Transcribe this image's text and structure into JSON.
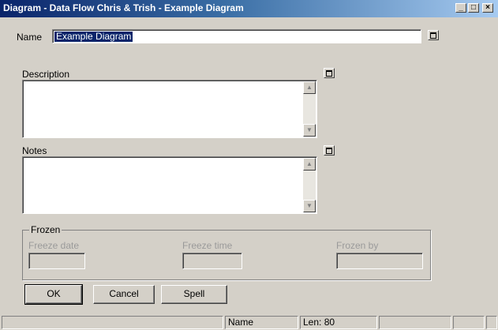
{
  "window": {
    "title": "Diagram - Data Flow Chris & Trish - Example Diagram",
    "minimize_label": "_",
    "maximize_label": "□",
    "close_label": "×"
  },
  "name": {
    "label": "Name",
    "value": "Example Diagram"
  },
  "description": {
    "label": "Description",
    "value": ""
  },
  "notes": {
    "label": "Notes",
    "value": ""
  },
  "scroll": {
    "up_glyph": "▲",
    "down_glyph": "▼"
  },
  "frozen": {
    "group_label": "Frozen",
    "freeze_date_label": "Freeze date",
    "freeze_time_label": "Freeze time",
    "frozen_by_label": "Frozen by",
    "freeze_date_value": "",
    "freeze_time_value": "",
    "frozen_by_value": ""
  },
  "buttons": {
    "ok": "OK",
    "cancel": "Cancel",
    "spell": "Spell"
  },
  "status": {
    "field": "Name",
    "length": "Len: 80"
  },
  "colors": {
    "titlebar_start": "#0a246a",
    "titlebar_end": "#a6caf0",
    "face": "#d4d0c8",
    "selection": "#0a246a"
  }
}
